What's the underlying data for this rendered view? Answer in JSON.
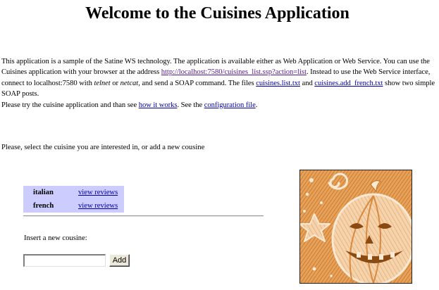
{
  "page": {
    "title": "Welcome to the Cuisines Application"
  },
  "intro": {
    "p1": "This application is a sample of the Satine WS technology. The application is available either as Web Application or Web Service. You can use the Cuisines application with your browser at the address ",
    "app_link": "http://localhost:7580/cuisines_list.ssp?action=list",
    "p2": ". Instead to use the Web Service interface, connect to localhost:7580 with ",
    "telnet": "telnet",
    "p3": " or ",
    "netcat": "netcat",
    "p4": ", and send a SOAP command. The files ",
    "file1_link": "cuisines.list.txt",
    "p5": " and ",
    "file2_link": "cuisines.add_french.txt",
    "p6": " show two simple SOAP posts.",
    "p7": "Please try the cuisine application and than see ",
    "how_link": "how it works",
    "p8": ". See the ",
    "config_link": "configuration file",
    "p9": "."
  },
  "select_prompt": "Please, select the cuisine you are interested in, or add a new cousine",
  "cuisines": [
    {
      "name": "italian",
      "link": "view reviews"
    },
    {
      "name": "french",
      "link": "view reviews"
    }
  ],
  "form": {
    "insert_label": "Insert a new cousine:",
    "input_value": "",
    "add_button": "Add"
  },
  "illustration": {
    "icon": "pumpkin-sun-illustration",
    "color": "#d9822b"
  }
}
